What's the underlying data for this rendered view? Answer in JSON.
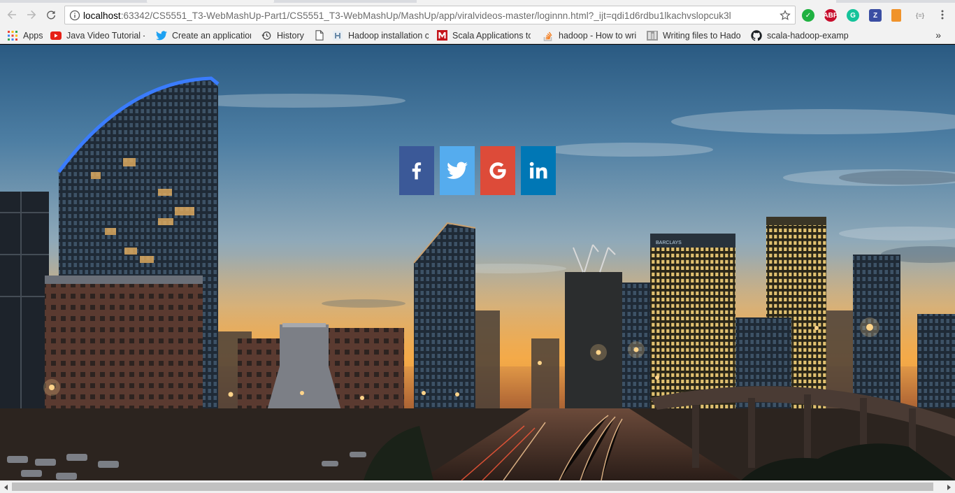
{
  "browser": {
    "url_host": "localhost",
    "url_rest": ":63342/CS5551_T3-WebMashUp-Part1/CS5551_T3-WebMashUp/MashUp/app/viralvideos-master/loginnn.html?_ijt=qdi1d6rdbu1lkachvslopcuk3l",
    "extensions": [
      {
        "name": "check-extension-icon",
        "label": "✓",
        "color": "#1fb141"
      },
      {
        "name": "adblock-plus-icon",
        "label": "ABP",
        "color": "#c70d2c"
      },
      {
        "name": "grammarly-icon",
        "label": "G",
        "color": "#15c39a"
      },
      {
        "name": "z-extension-icon",
        "label": "Z",
        "color": "#3b4ea3"
      },
      {
        "name": "calculator-icon",
        "label": "",
        "color": "#f0932b"
      },
      {
        "name": "json-extension-icon",
        "label": "{≡}",
        "color": "#9a9a9a"
      }
    ]
  },
  "bookmarks": {
    "apps": "Apps",
    "items": [
      {
        "label": "Java Video Tutorial -",
        "icon": "youtube-icon"
      },
      {
        "label": "Create an application",
        "icon": "twitter-icon"
      },
      {
        "label": "History",
        "icon": "history-icon"
      },
      {
        "label": "",
        "icon": "page-icon"
      },
      {
        "label": "Hadoop installation c",
        "icon": "hadoop-icon"
      },
      {
        "label": "Scala Applications to",
        "icon": "m-icon"
      },
      {
        "label": "hadoop - How to wri",
        "icon": "stackoverflow-icon"
      },
      {
        "label": "Writing files to Hado",
        "icon": "image-icon"
      },
      {
        "label": "scala-hadoop-examp",
        "icon": "github-icon"
      }
    ],
    "more": "»"
  },
  "social": {
    "buttons": [
      {
        "name": "facebook",
        "color": "#3b5998",
        "icon": "facebook-icon"
      },
      {
        "name": "twitter",
        "color": "#55acee",
        "icon": "twitter-icon"
      },
      {
        "name": "google",
        "color": "#dd4b39",
        "icon": "google-icon"
      },
      {
        "name": "linkedin",
        "color": "#0077b5",
        "icon": "linkedin-icon"
      }
    ]
  },
  "colors": {
    "sky_top": "#2f5f86",
    "sky_mid": "#8ba8be",
    "sunset": "#e9a64a",
    "city_dark": "#1d2530"
  }
}
